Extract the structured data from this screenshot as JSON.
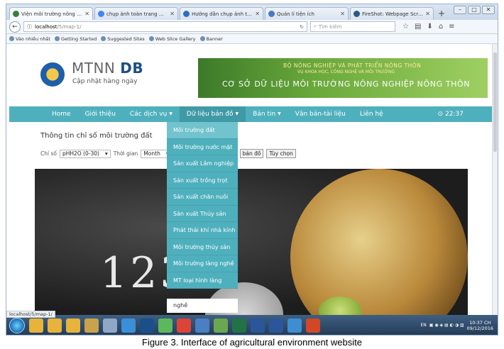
{
  "browser": {
    "tabs": [
      {
        "title": "Viện môi trường nông ngh...",
        "icon": "site-favicon",
        "color": "#3b7d3a",
        "active": true
      },
      {
        "title": "chụp ảnh toàn trang web -...",
        "icon": "google-icon",
        "color": "#4285f4",
        "active": false
      },
      {
        "title": "Hướng dẫn chụp ảnh toàn ...",
        "icon": "blue-favicon",
        "color": "#2d6fc1",
        "active": false
      },
      {
        "title": "Quản lí tiện ích",
        "icon": "puzzle-icon",
        "color": "#4a78c2",
        "active": false
      },
      {
        "title": "FireShot: Webpage Screens...",
        "icon": "fireshot-icon",
        "color": "#2a5a8a",
        "active": false
      }
    ],
    "new_tab": "+",
    "url_host": "localhost",
    "url_path": "/5/map-1/",
    "search_placeholder": "Tìm kiếm",
    "bookmarks": [
      "Vào nhiều nhất",
      "Getting Started",
      "Suggested Sites",
      "Web Slice Gallery",
      "Banner"
    ]
  },
  "site": {
    "logo_title_light": "MTNN",
    "logo_title_bold": "DB",
    "logo_subtitle": "Cập nhật hàng ngày",
    "banner_line1": "BỘ NÔNG NGHIỆP VÀ PHÁT TRIỂN NÔNG THÔN",
    "banner_line2": "VỤ KHOA HỌC, CÔNG NGHỆ VÀ MÔI TRƯỜNG",
    "banner_line3": "CƠ SỞ DỮ LIỆU MÔI TRƯỜNG NÔNG NGHIỆP NÔNG THÔN",
    "menu": {
      "home": "Home",
      "about": "Giới thiệu",
      "services": "Các dịch vụ",
      "map_data": "Dữ liệu bản đồ",
      "news": "Bản tin",
      "documents": "Văn bản-tài liệu",
      "contact": "Liên hệ",
      "clock": "22:37"
    },
    "page_title": "Thông tin chỉ số môi trường đất",
    "filters": {
      "indicator_label": "Chỉ số",
      "indicator_value": "pHH2O (0-30)",
      "time_label": "Thời gian",
      "time_value": "Month",
      "map_button": "bản đồ",
      "options_button": "Tùy chọn"
    },
    "dropdown": [
      "Môi trường đất",
      "Môi trường nước mặt",
      "Sản xuất Lâm nghiệp",
      "Sản xuất trồng trọt",
      "Sản xuất chăn nuôi",
      "Sản xuất Thủy sản",
      "Phát thải khí nhà kính",
      "Môi trường thủy sản",
      "Môi trường làng nghề",
      "MT loại hình làng"
    ],
    "dropdown_tail": "nghề",
    "hero_numbers": "123"
  },
  "status_url": "localhost/5/map-1/",
  "taskbar": {
    "lang": "EN",
    "time": "10:37 CH",
    "date": "09/12/2016"
  },
  "caption": "Figure 3. Interface of agricultural environment website",
  "colors": {
    "menu_bg": "#4fb0bd",
    "dropdown_active": "#71c3cd"
  }
}
